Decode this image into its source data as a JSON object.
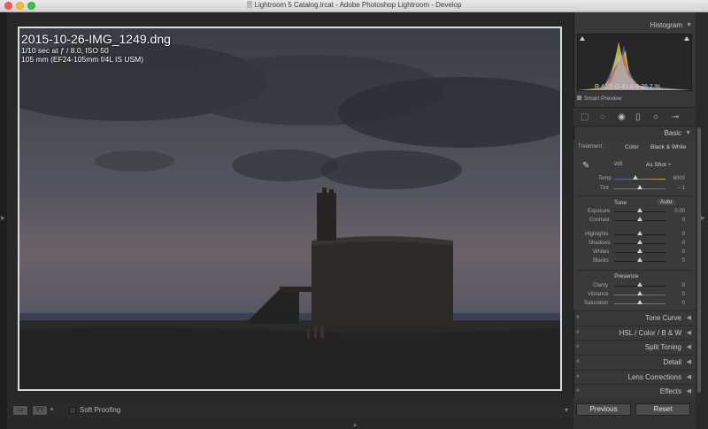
{
  "window": {
    "title": "Lightroom 5 Catalog.lrcat - Adobe Photoshop Lightroom - Develop"
  },
  "photo_overlay": {
    "filename": "2015-10-26-IMG_1249.dng",
    "exposure_line": "1/10 sec at ƒ / 8.0, ISO 50",
    "lens_line": "105 mm (EF24-105mm f/4L IS USM)"
  },
  "toolbar": {
    "view_button": "▭",
    "compare_button": "YY",
    "soft_proofing_label": "Soft Proofing"
  },
  "histogram": {
    "title": "Histogram",
    "readout": "R  42.5   G  40.8   B  38.7  %",
    "smart_preview": "Smart Preview"
  },
  "basic": {
    "title": "Basic",
    "treatment_label": "Treatment :",
    "color": "Color",
    "bw": "Black & White",
    "wb_label": "WB :",
    "wb_value": "As Shot ÷",
    "temp_label": "Temp",
    "temp_value": "6000",
    "tint_label": "Tint",
    "tint_value": "– 1",
    "tone_label": "Tone",
    "auto_label": "Auto",
    "exposure_label": "Exposure",
    "exposure_value": "0.00",
    "contrast_label": "Contrast",
    "contrast_value": "0",
    "highlights_label": "Highlights",
    "highlights_value": "0",
    "shadows_label": "Shadows",
    "shadows_value": "0",
    "whites_label": "Whites",
    "whites_value": "0",
    "blacks_label": "Blacks",
    "blacks_value": "0",
    "presence_label": "Presence",
    "clarity_label": "Clarity",
    "clarity_value": "0",
    "vibrance_label": "Vibrance",
    "vibrance_value": "0",
    "saturation_label": "Saturation",
    "saturation_value": "0"
  },
  "panels": {
    "tone_curve": "Tone Curve",
    "hsl": "HSL  /  Color  /  B & W",
    "split_toning": "Split Toning",
    "detail": "Detail",
    "lens_corrections": "Lens Corrections",
    "effects": "Effects"
  },
  "buttons": {
    "previous": "Previous",
    "reset": "Reset"
  },
  "icons": {
    "panel_collapse": "triangle-down",
    "panel_expand": "triangle-left"
  }
}
